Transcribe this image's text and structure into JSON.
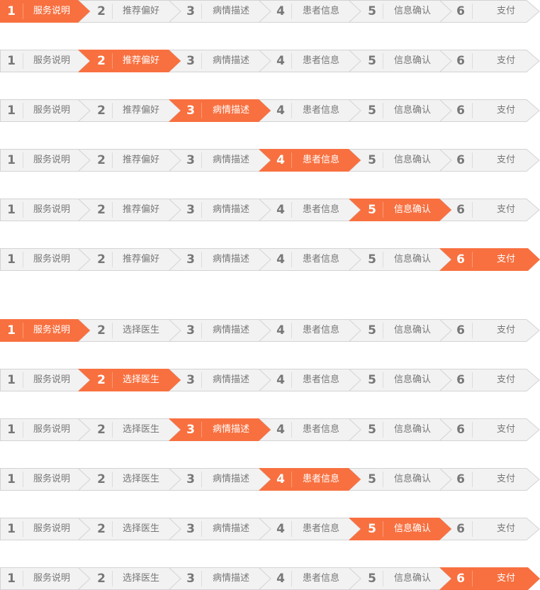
{
  "colors": {
    "active": "#f87040",
    "inactive": "#f2f2f2",
    "border": "#d3d3d3",
    "divider": "#dcdcdc",
    "text": "#777777",
    "active_text": "#ffffff"
  },
  "wizards": [
    {
      "name": "flow-recommendation",
      "steps": [
        {
          "num": "1",
          "label": "服务说明"
        },
        {
          "num": "2",
          "label": "推荐偏好"
        },
        {
          "num": "3",
          "label": "病情描述"
        },
        {
          "num": "4",
          "label": "患者信息"
        },
        {
          "num": "5",
          "label": "信息确认"
        },
        {
          "num": "6",
          "label": "支付"
        }
      ],
      "active_states": [
        1,
        2,
        3,
        4,
        5,
        6
      ]
    },
    {
      "name": "flow-choose-doctor",
      "steps": [
        {
          "num": "1",
          "label": "服务说明"
        },
        {
          "num": "2",
          "label": "选择医生"
        },
        {
          "num": "3",
          "label": "病情描述"
        },
        {
          "num": "4",
          "label": "患者信息"
        },
        {
          "num": "5",
          "label": "信息确认"
        },
        {
          "num": "6",
          "label": "支付"
        }
      ],
      "active_states": [
        1,
        2,
        3,
        4,
        5,
        6
      ]
    }
  ]
}
